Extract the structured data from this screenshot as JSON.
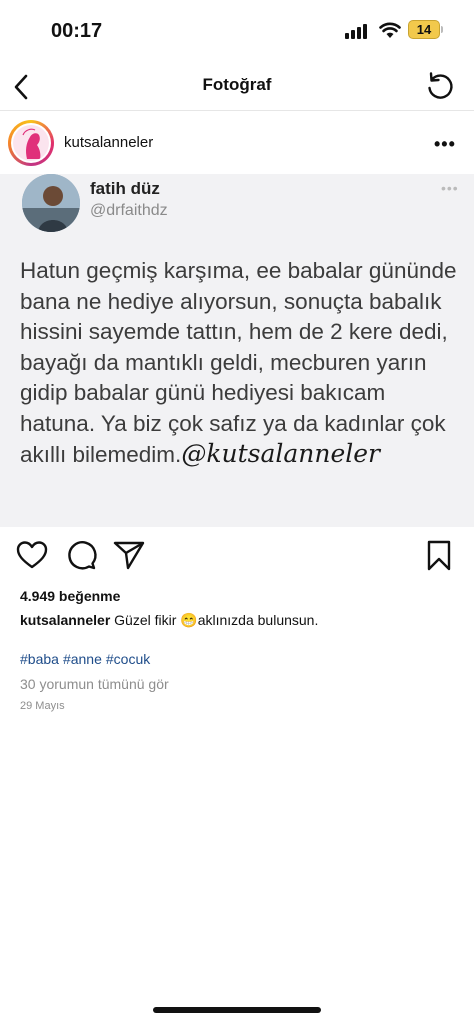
{
  "status_bar": {
    "time": "00:17",
    "battery": "14"
  },
  "nav": {
    "title": "Fotoğraf"
  },
  "post": {
    "username": "kutsalanneler",
    "image": {
      "author_name": "fatih düz",
      "author_handle": "@drfaithdz",
      "tweet_text": "Hatun geçmiş karşıma, ee babalar gününde bana ne hediye alıyorsun, sonuçta babalık hissini sayemde tattın, hem de 2 kere dedi, bayağı da mantıklı geldi, mecburen yarın gidip babalar günü hediyesi bakıcam hatuna. Ya biz çok safız ya da kadınlar çok akıllı bilemedim.",
      "watermark": "@kutsalanneler"
    },
    "likes": "4.949 beğenme",
    "caption_user": "kutsalanneler",
    "caption_text": "Güzel fikir 😁aklınızda bulunsun.",
    "hashtags": [
      "#baba",
      "#anne",
      "#cocuk"
    ],
    "view_comments": "30 yorumun tümünü gör",
    "date": "29 Mayıs"
  }
}
